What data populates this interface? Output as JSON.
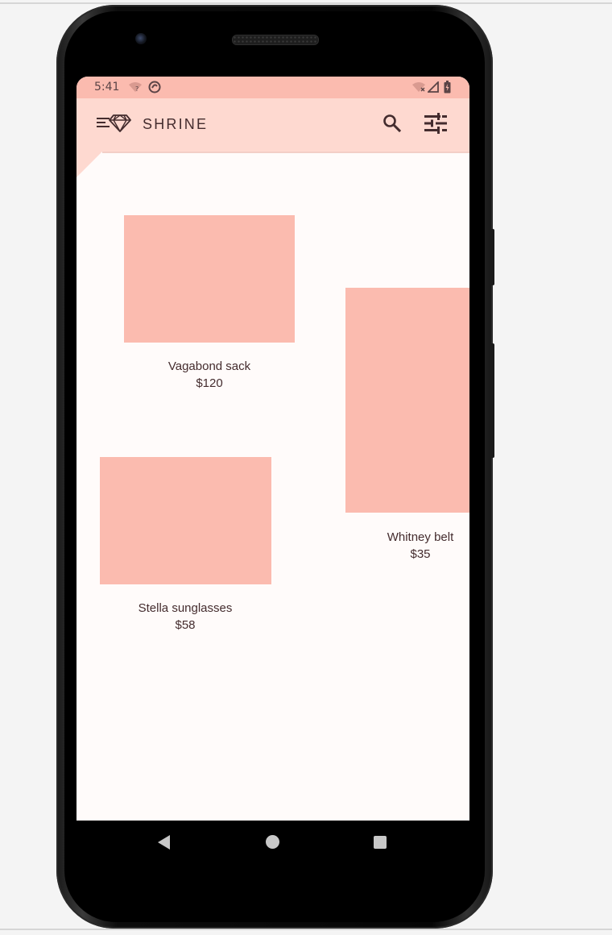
{
  "status_bar": {
    "time": "5:41",
    "icons_left": [
      "wifi-question-icon",
      "sync-icon"
    ],
    "icons_right": [
      "wifi-off-icon",
      "signal-icon",
      "battery-charging-icon"
    ]
  },
  "app_bar": {
    "brand": "SHRINE",
    "menu_icon": "menu-diamond-icon",
    "search_icon": "search-icon",
    "filter_icon": "tune-icon"
  },
  "products": [
    {
      "name": "Vagabond sack",
      "price": "$120"
    },
    {
      "name": "Whitney belt",
      "price": "$35"
    },
    {
      "name": "Stella sunglasses",
      "price": "$58"
    }
  ],
  "colors": {
    "primary": "#fed9d0",
    "status_bar": "#fbbbaf",
    "placeholder": "#fbbbaf",
    "on_primary": "#442c2e",
    "surface": "#fffbfa"
  },
  "nav_bar": {
    "icons": [
      "back-icon",
      "home-icon",
      "recents-icon"
    ]
  }
}
